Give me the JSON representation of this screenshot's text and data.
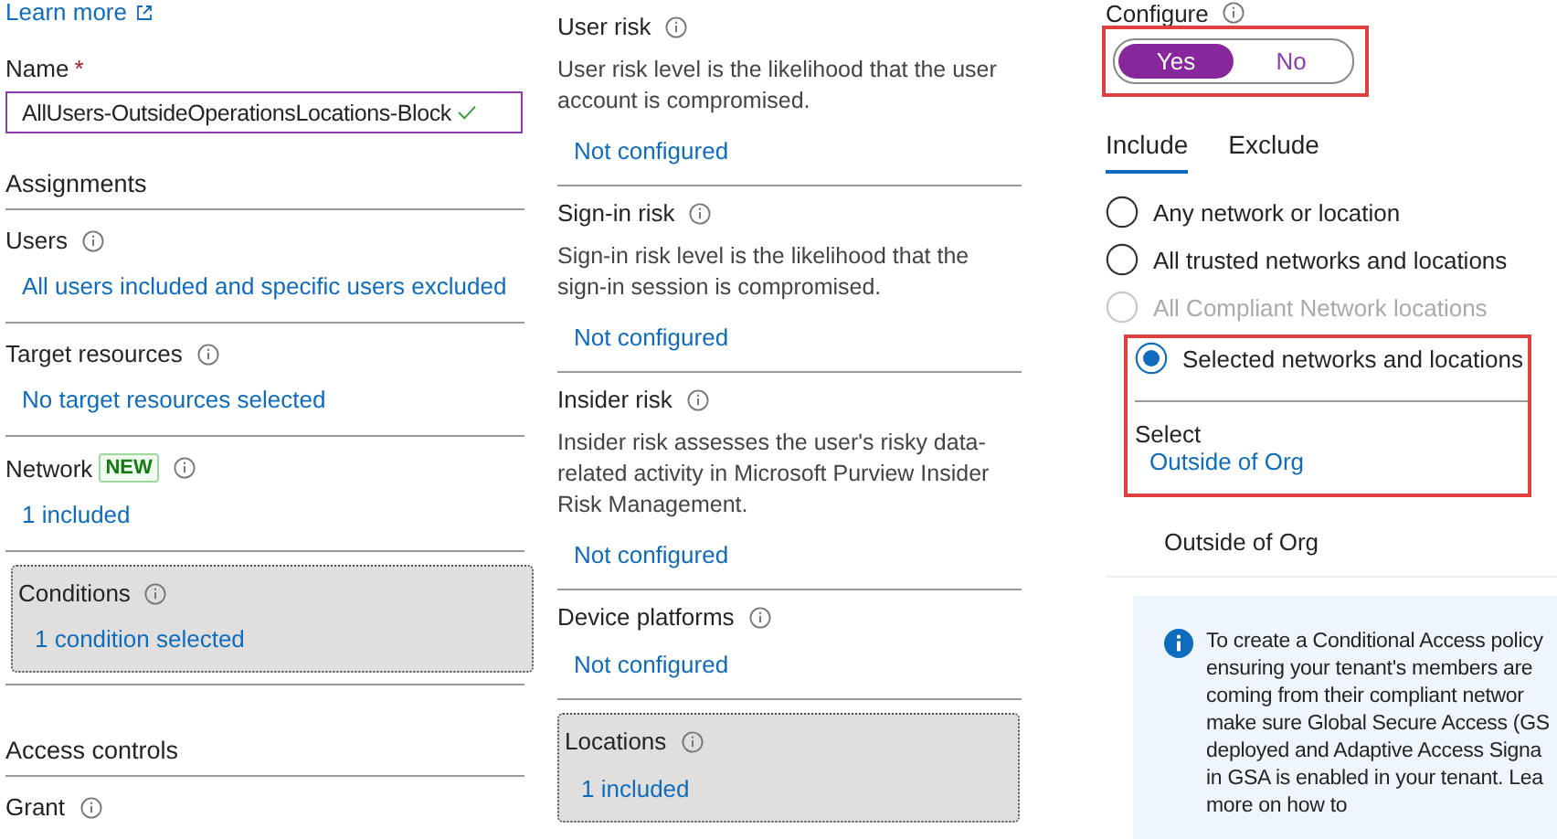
{
  "learn_more": {
    "label": "Learn more"
  },
  "name_field": {
    "label": "Name",
    "required_mark": "*",
    "value": "AllUsers-OutsideOperationsLocations-Block",
    "valid": true
  },
  "assignments": {
    "title": "Assignments",
    "items": [
      {
        "label": "Users",
        "link": "All users included and specific users excluded",
        "selected": false
      },
      {
        "label": "Target resources",
        "link": "No target resources selected",
        "selected": false
      },
      {
        "label": "Network",
        "badge": "NEW",
        "link": "1 included",
        "selected": false
      },
      {
        "label": "Conditions",
        "link": "1 condition selected",
        "selected": true
      }
    ]
  },
  "access_controls": {
    "title": "Access controls",
    "items": [
      {
        "label": "Grant"
      }
    ]
  },
  "conditions": [
    {
      "label": "User risk",
      "description": "User risk level is the likelihood that the user account is compromised.",
      "link": "Not configured",
      "selected": false
    },
    {
      "label": "Sign-in risk",
      "description": "Sign-in risk level is the likelihood that the sign-in session is compromised.",
      "link": "Not configured",
      "selected": false
    },
    {
      "label": "Insider risk",
      "description": "Insider risk assesses the user's risky data-related activity in Microsoft Purview Insider Risk Management.",
      "link": "Not configured",
      "selected": false
    },
    {
      "label": "Device platforms",
      "link": "Not configured",
      "selected": false
    },
    {
      "label": "Locations",
      "link": "1 included",
      "selected": true
    }
  ],
  "locations": {
    "configure": {
      "label": "Configure",
      "options": [
        {
          "label": "Yes",
          "selected": true
        },
        {
          "label": "No",
          "selected": false
        }
      ]
    },
    "tabs": [
      {
        "label": "Include",
        "selected": true
      },
      {
        "label": "Exclude",
        "selected": false
      }
    ],
    "options": [
      {
        "label": "Any network or location",
        "selected": false,
        "disabled": false
      },
      {
        "label": "All trusted networks and locations",
        "selected": false,
        "disabled": false
      },
      {
        "label": "All Compliant Network locations",
        "selected": false,
        "disabled": true
      },
      {
        "label": "Selected networks and locations",
        "selected": true,
        "disabled": false
      }
    ],
    "select": {
      "label": "Select",
      "link": "Outside of Org"
    },
    "selected_items": [
      "Outside of Org"
    ],
    "info": {
      "lines": [
        "To create a Conditional Access policy",
        "ensuring your tenant's members are",
        "coming from their compliant networ",
        "make sure Global Secure Access (GS",
        "deployed and Adaptive Access Signa",
        "in GSA is enabled in your tenant. Lea",
        "more on how to"
      ]
    }
  }
}
